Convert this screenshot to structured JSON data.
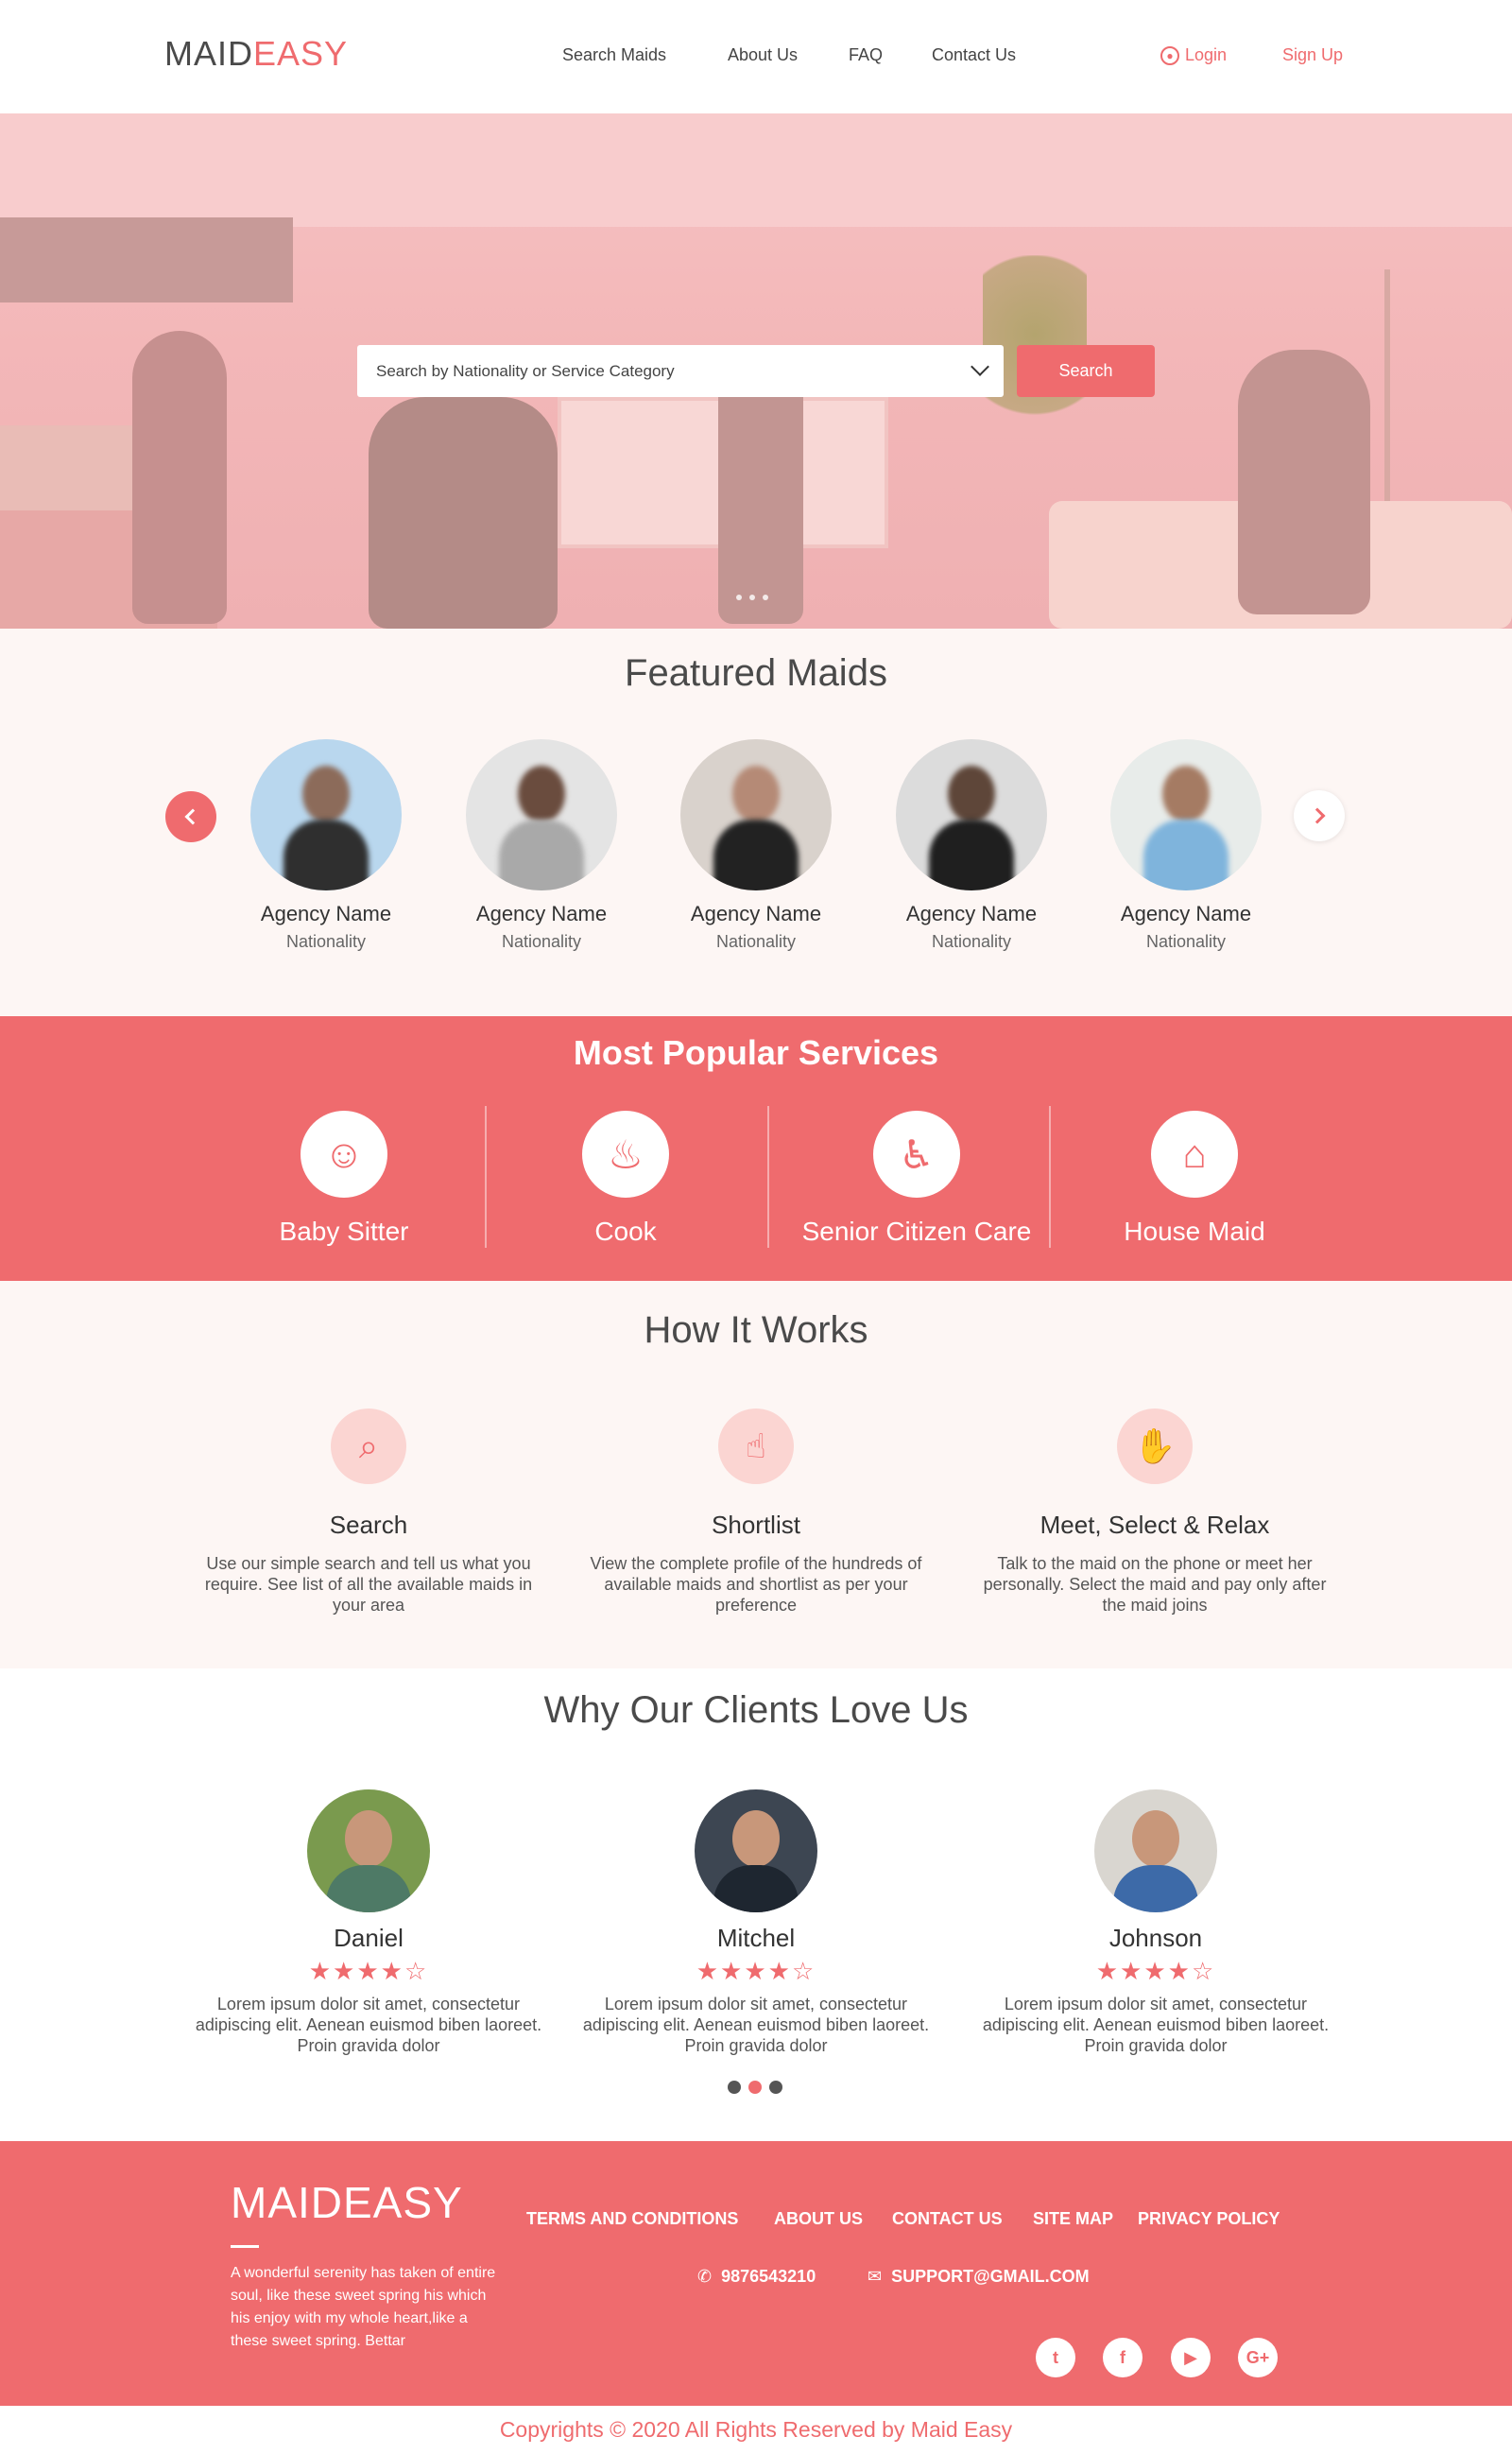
{
  "nav": {
    "logo_left": "MAID",
    "logo_right": "EASY",
    "links": [
      "Search Maids",
      "About Us",
      "FAQ",
      "Contact Us"
    ],
    "login": "Login",
    "signup": "Sign Up"
  },
  "hero": {
    "search_placeholder": "Search by Nationality or Service Category",
    "search_button": "Search"
  },
  "featured": {
    "title": "Featured Maids",
    "maids": [
      {
        "name": "Agency Name",
        "nationality": "Nationality"
      },
      {
        "name": "Agency Name",
        "nationality": "Nationality"
      },
      {
        "name": "Agency Name",
        "nationality": "Nationality"
      },
      {
        "name": "Agency Name",
        "nationality": "Nationality"
      },
      {
        "name": "Agency Name",
        "nationality": "Nationality"
      }
    ]
  },
  "services": {
    "title": "Most Popular Services",
    "items": [
      {
        "label": "Baby Sitter",
        "icon": "baby-sitter-icon"
      },
      {
        "label": "Cook",
        "icon": "cook-icon"
      },
      {
        "label": "Senior Citizen Care",
        "icon": "senior-care-icon"
      },
      {
        "label": "House Maid",
        "icon": "house-maid-icon"
      }
    ]
  },
  "how": {
    "title": "How It Works",
    "steps": [
      {
        "title": "Search",
        "text": "Use our simple search and tell us what you require. See list of all the available maids in your area",
        "icon": "search-person-icon"
      },
      {
        "title": "Shortlist",
        "text": "View the complete profile of the hundreds of available maids and shortlist as per your preference",
        "icon": "shortlist-icon"
      },
      {
        "title": "Meet, Select & Relax",
        "text": "Talk to the maid on the phone or meet her personally. Select the maid and pay only after the maid joins",
        "icon": "handshake-icon"
      }
    ]
  },
  "testimonials": {
    "title": "Why Our Clients Love Us",
    "clients": [
      {
        "name": "Daniel",
        "rating": 4,
        "stars": "★★★★☆",
        "text": "Lorem ipsum dolor sit amet, consectetur adipiscing elit. Aenean euismod biben laoreet. Proin gravida dolor"
      },
      {
        "name": "Mitchel",
        "rating": 4,
        "stars": "★★★★☆",
        "text": "Lorem ipsum dolor sit amet, consectetur adipiscing elit. Aenean euismod biben laoreet. Proin gravida dolor"
      },
      {
        "name": "Johnson",
        "rating": 4,
        "stars": "★★★★☆",
        "text": "Lorem ipsum dolor sit amet, consectetur adipiscing elit. Aenean euismod biben laoreet. Proin gravida dolor"
      }
    ]
  },
  "footer": {
    "logo": "MAIDEASY",
    "about": "A wonderful serenity has taken of entire soul, like these sweet spring his which his enjoy with my whole heart,like a these sweet spring. Bettar",
    "links": [
      "TERMS AND CONDITIONS",
      "ABOUT US",
      "CONTACT US",
      "SITE MAP",
      "PRIVACY POLICY"
    ],
    "phone": "9876543210",
    "email": "SUPPORT@GMAIL.COM",
    "social": [
      "twitter-icon",
      "facebook-icon",
      "youtube-icon",
      "google-plus-icon"
    ]
  },
  "copyright": "Copyrights © 2020 All Rights Reserved by Maid Easy",
  "colors": {
    "accent": "#ef6b6e",
    "section_bg": "#fdf6f4"
  }
}
